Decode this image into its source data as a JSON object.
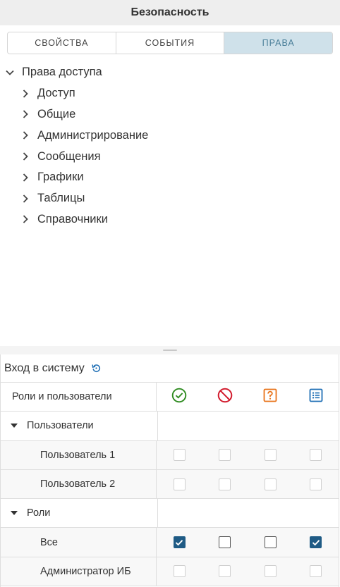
{
  "header": {
    "title": "Безопасность"
  },
  "tabs": [
    {
      "label": "СВОЙСТВА"
    },
    {
      "label": "СОБЫТИЯ"
    },
    {
      "label": "ПРАВА"
    }
  ],
  "tree": {
    "root": "Права доступа",
    "items": [
      "Доступ",
      "Общие",
      "Администрирование",
      "Сообщения",
      "Графики",
      "Таблицы",
      "Справочники"
    ]
  },
  "panel": {
    "title": "Вход в систему",
    "column_header": "Роли и пользователи",
    "perm_icons": [
      "check-circle-icon",
      "forbidden-icon",
      "question-box-icon",
      "list-icon"
    ],
    "colors": {
      "allow": "#2e8b20",
      "deny": "#d21a2c",
      "ask": "#e8731a",
      "list": "#1f6fb5",
      "checked": "#1f5b85"
    }
  },
  "groups": [
    {
      "label": "Пользователи",
      "rows": [
        {
          "label": "Пользователь 1",
          "checks": [
            false,
            false,
            false,
            false
          ]
        },
        {
          "label": "Пользователь 2",
          "checks": [
            false,
            false,
            false,
            false
          ]
        }
      ]
    },
    {
      "label": "Роли",
      "rows": [
        {
          "label": "Все",
          "checks": [
            true,
            false,
            false,
            true
          ]
        },
        {
          "label": "Администратор ИБ",
          "checks": [
            false,
            false,
            false,
            false
          ]
        }
      ]
    }
  ]
}
